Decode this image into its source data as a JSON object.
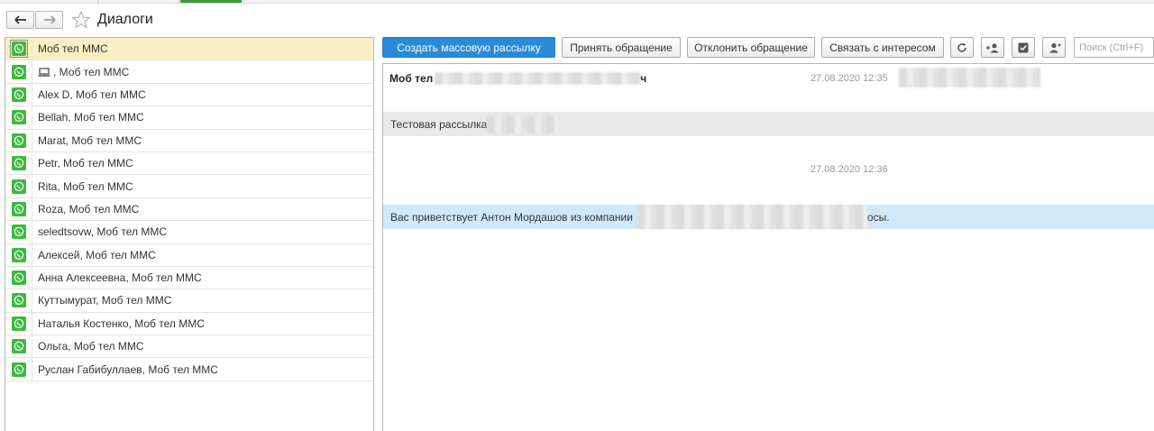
{
  "window": {
    "title": "Диалоги"
  },
  "dialogs": [
    {
      "label": "Моб тел ММС",
      "selected": true,
      "device_icon": false
    },
    {
      "label": ", Моб тел ММС",
      "selected": false,
      "device_icon": true
    },
    {
      "label": "Alex D, Моб тел ММС",
      "selected": false,
      "device_icon": false
    },
    {
      "label": "Bellah, Моб тел ММС",
      "selected": false,
      "device_icon": false
    },
    {
      "label": "Marat, Моб тел ММС",
      "selected": false,
      "device_icon": false
    },
    {
      "label": "Petr, Моб тел ММС",
      "selected": false,
      "device_icon": false
    },
    {
      "label": "Rita, Моб тел ММС",
      "selected": false,
      "device_icon": false
    },
    {
      "label": "Roza, Моб тел ММС",
      "selected": false,
      "device_icon": false
    },
    {
      "label": "seledtsovw, Моб тел ММС",
      "selected": false,
      "device_icon": false
    },
    {
      "label": "Алексей, Моб тел ММС",
      "selected": false,
      "device_icon": false
    },
    {
      "label": "Анна Алексеевна, Моб тел ММС",
      "selected": false,
      "device_icon": false
    },
    {
      "label": "Куттымурат, Моб тел ММС",
      "selected": false,
      "device_icon": false
    },
    {
      "label": "Наталья Костенко, Моб тел ММС",
      "selected": false,
      "device_icon": false
    },
    {
      "label": "Ольга, Моб тел ММС",
      "selected": false,
      "device_icon": false
    },
    {
      "label": "Руслан Габибуллаев, Моб тел ММС",
      "selected": false,
      "device_icon": false
    }
  ],
  "toolbar": {
    "create_mailing": "Создать массовую рассылку",
    "accept_request": "Принять обращение",
    "reject_request": "Отклонить обращение",
    "link_interest": "Связать с интересом",
    "search_placeholder": "Поиск (Ctrl+F)"
  },
  "conversation": {
    "header_prefix": "Моб тел",
    "header_suffix": "ч",
    "time_1": "27.08.2020 12:35",
    "outgoing_text": "Тестовая рассылка",
    "time_2": "27.08.2020 12:36",
    "incoming_prefix": "Вас приветствует Антон Мордашов из компании",
    "incoming_suffix": "осы."
  },
  "colors": {
    "primary_button": "#2a8ad9",
    "selected_row": "#fbeec3",
    "incoming_bubble": "#cfe9f8",
    "outgoing_bubble": "#e9e9e9",
    "whatsapp_green": "#3cba3c"
  }
}
